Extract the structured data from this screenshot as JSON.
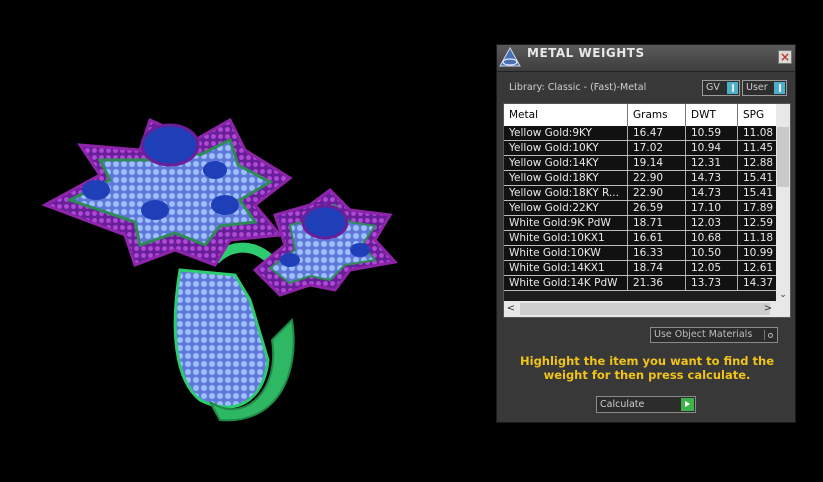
{
  "panel": {
    "title": "METAL WEIGHTS",
    "close_label": "×",
    "library": "Library: Classic - (Fast)-Metal",
    "gv_toggle": "GV",
    "user_toggle": "User",
    "columns": [
      "Metal",
      "Grams",
      "DWT",
      "SPG"
    ],
    "rows": [
      [
        "Yellow Gold:9KY",
        "16.47",
        "10.59",
        "11.08"
      ],
      [
        "Yellow Gold:10KY",
        "17.02",
        "10.94",
        "11.45"
      ],
      [
        "Yellow Gold:14KY",
        "19.14",
        "12.31",
        "12.88"
      ],
      [
        "Yellow Gold:18KY",
        "22.90",
        "14.73",
        "15.41"
      ],
      [
        "Yellow Gold:18KY R...",
        "22.90",
        "14.73",
        "15.41"
      ],
      [
        "Yellow Gold:22KY",
        "26.59",
        "17.10",
        "17.89"
      ],
      [
        "White Gold:9K PdW",
        "18.71",
        "12.03",
        "12.59"
      ],
      [
        "White Gold:10KX1",
        "16.61",
        "10.68",
        "11.18"
      ],
      [
        "White Gold:10KW",
        "16.33",
        "10.50",
        "10.99"
      ],
      [
        "White Gold:14KX1",
        "18.74",
        "12.05",
        "12.61"
      ],
      [
        "White Gold:14K PdW",
        "21.36",
        "13.73",
        "14.37"
      ]
    ],
    "use_object_materials": "Use Object Materials",
    "hint": "Highlight the item you want to find the weight for then press calculate.",
    "calculate_label": "Calculate"
  },
  "colors": {
    "hint_text": "#f0c419",
    "ring_band": "#2ecc71",
    "prong": "#8e24aa",
    "stone_blue": "#1e3fb8",
    "pave_light": "#8fb4ff"
  }
}
